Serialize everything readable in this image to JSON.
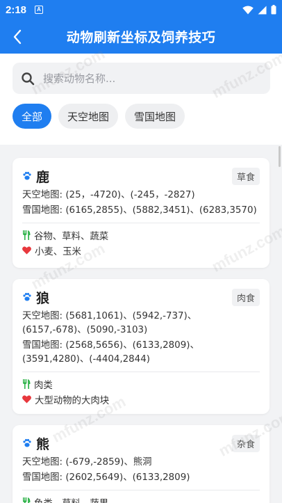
{
  "status_bar": {
    "time": "2:18",
    "app_badge": "A"
  },
  "header": {
    "title": "动物刷新坐标及饲养技巧"
  },
  "search": {
    "placeholder": "搜索动物名称..."
  },
  "filters": [
    {
      "label": "全部",
      "active": true
    },
    {
      "label": "天空地图",
      "active": false
    },
    {
      "label": "雪国地图",
      "active": false
    }
  ],
  "animals": [
    {
      "name": "鹿",
      "diet": "草食",
      "sky": "天空地图: (25，-4720)、(-245，-2827)",
      "snow": "雪国地图: (6165,2855)、(5882,3451)、(6283,3570)",
      "food": "谷物、草料、蔬菜",
      "favorite": "小麦、玉米"
    },
    {
      "name": "狼",
      "diet": "肉食",
      "sky": "天空地图: (5681,1061)、(5942,-737)、(6157,-678)、(5090,-3103)",
      "snow": "雪国地图: (2568,5656)、(6133,2809)、(3591,4280)、(-4404,2844)",
      "food": "肉类",
      "favorite": "大型动物的大肉块"
    },
    {
      "name": "熊",
      "diet": "杂食",
      "sky": "天空地图: (-679,-2859)、熊洞",
      "snow": "雪国地图: (2602,5649)、(6133,2809)",
      "food": "鱼类、草料、蔬果",
      "favorite": ""
    }
  ],
  "watermark": "mfunz.com",
  "colors": {
    "primary": "#1f7ef0",
    "food_icon": "#2fb34a",
    "heart": "#e8383d"
  }
}
